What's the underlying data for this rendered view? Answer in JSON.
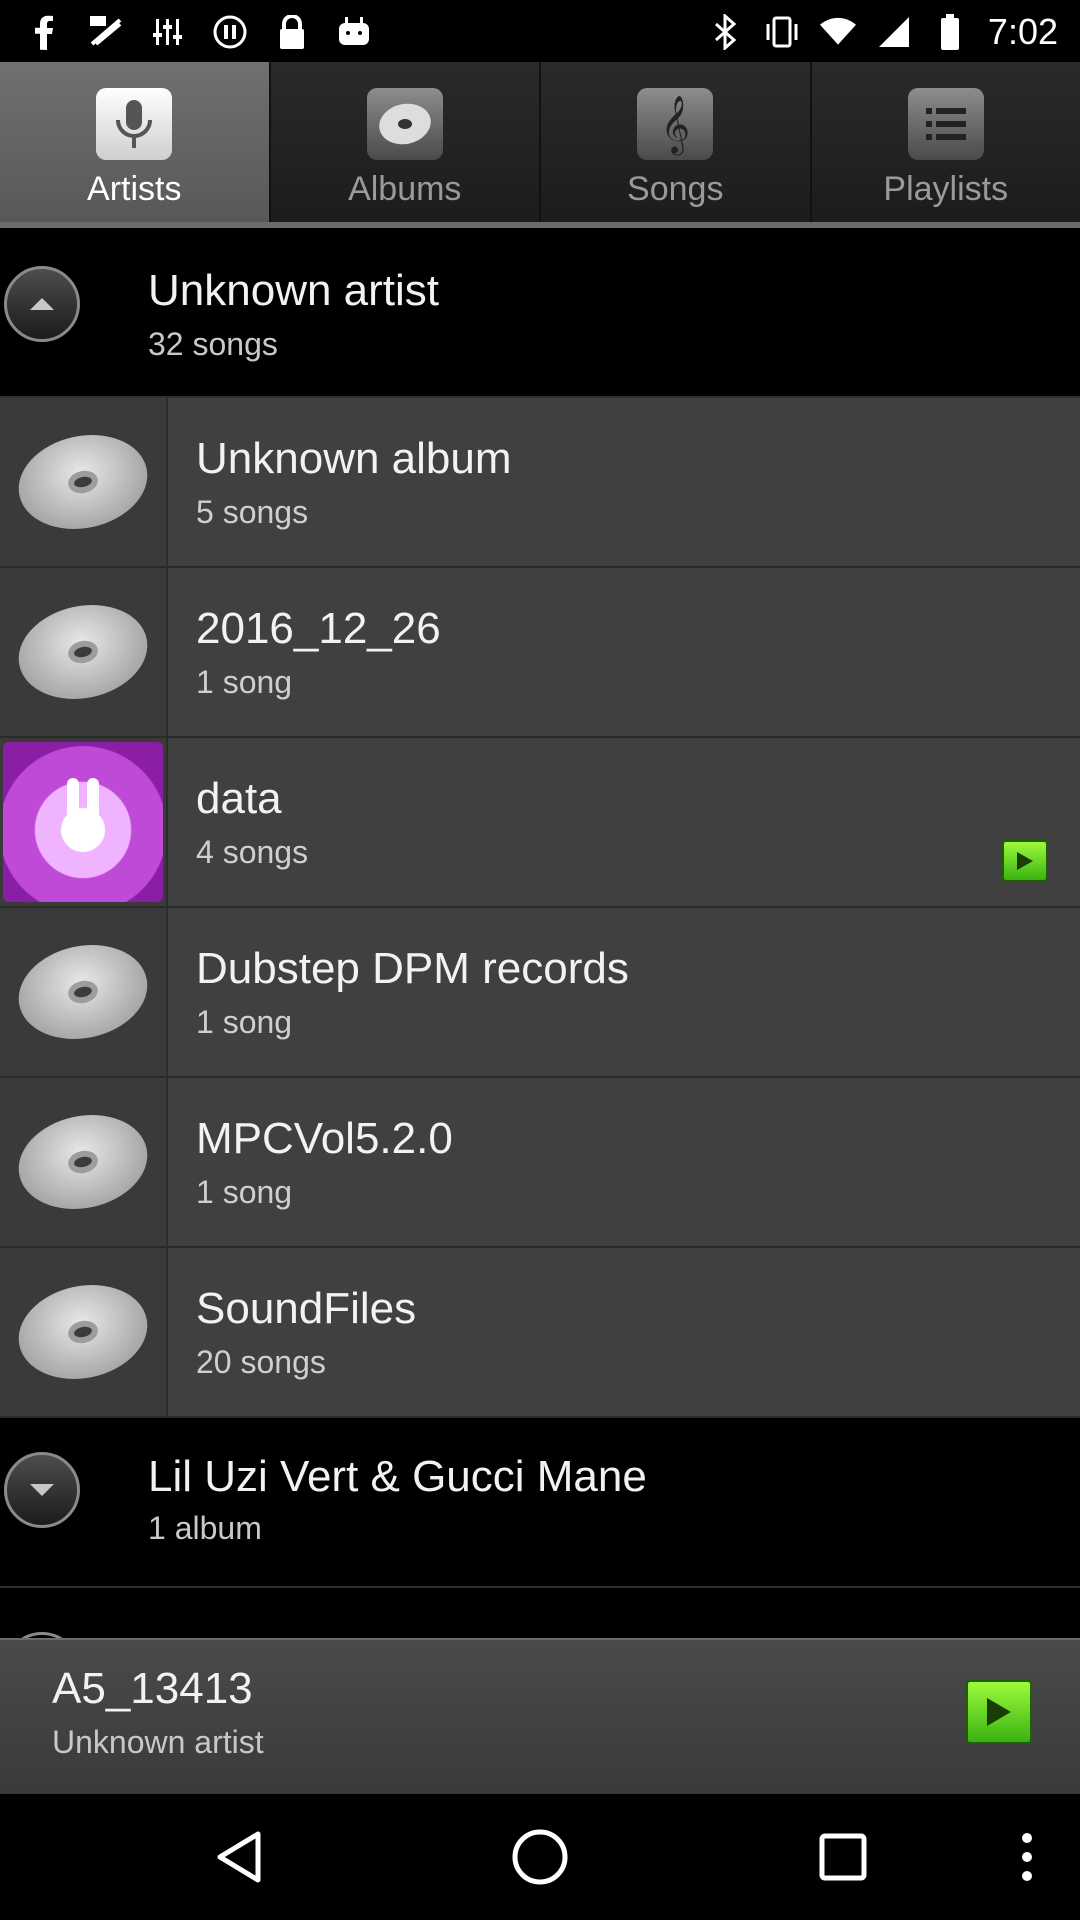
{
  "status_bar": {
    "time": "7:02",
    "left_icons": [
      "facebook-icon",
      "fake-icon",
      "equalizer-icon",
      "pause-icon",
      "lock-icon",
      "android-icon"
    ],
    "right_icons": [
      "bluetooth-icon",
      "vibrate-icon",
      "wifi-icon",
      "signal-icon",
      "battery-icon"
    ]
  },
  "tabs": [
    {
      "label": "Artists",
      "icon": "microphone-icon",
      "active": true
    },
    {
      "label": "Albums",
      "icon": "disc-icon",
      "active": false
    },
    {
      "label": "Songs",
      "icon": "treble-clef-icon",
      "active": false
    },
    {
      "label": "Playlists",
      "icon": "list-icon",
      "active": false
    }
  ],
  "artists": [
    {
      "title": "Unknown artist",
      "subtitle": "32 songs",
      "expanded": true,
      "albums": [
        {
          "title": "Unknown album",
          "subtitle": "5 songs",
          "art": "disc"
        },
        {
          "title": "2016_12_26",
          "subtitle": "1 song",
          "art": "disc"
        },
        {
          "title": "data",
          "subtitle": "4 songs",
          "art": "bunny-artwork",
          "playing": true
        },
        {
          "title": "Dubstep DPM records",
          "subtitle": "1 song",
          "art": "disc"
        },
        {
          "title": "MPCVol5.2.0",
          "subtitle": "1 song",
          "art": "disc"
        },
        {
          "title": "SoundFiles",
          "subtitle": "20 songs",
          "art": "disc"
        }
      ]
    },
    {
      "title": "Lil Uzi Vert & Gucci Mane",
      "subtitle": "1 album",
      "expanded": false
    }
  ],
  "now_playing": {
    "title": "A5_13413",
    "artist": "Unknown artist"
  },
  "colors": {
    "accent_play": "#4ccf1c",
    "tab_active_bg": "#636363",
    "row_bg": "#404040"
  }
}
